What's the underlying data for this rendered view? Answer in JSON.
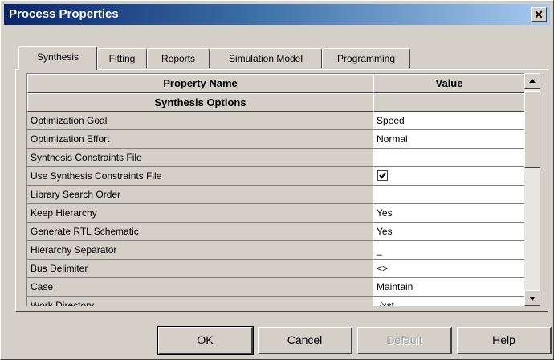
{
  "window": {
    "title": "Process Properties",
    "close_glyph": "✕"
  },
  "tabs": [
    {
      "label": "Synthesis",
      "active": true
    },
    {
      "label": "Fitting",
      "active": false
    },
    {
      "label": "Reports",
      "active": false
    },
    {
      "label": "Simulation Model",
      "active": false
    },
    {
      "label": "Programming",
      "active": false
    }
  ],
  "grid": {
    "columns": {
      "name": "Property Name",
      "value": "Value"
    },
    "section": "Synthesis Options",
    "rows": [
      {
        "name": "Optimization Goal",
        "value": "Speed"
      },
      {
        "name": "Optimization Effort",
        "value": "Normal"
      },
      {
        "name": "Synthesis Constraints File",
        "value": ""
      },
      {
        "name": "Use Synthesis Constraints File",
        "value": "",
        "checked": true
      },
      {
        "name": "Library Search Order",
        "value": ""
      },
      {
        "name": "Keep Hierarchy",
        "value": "Yes"
      },
      {
        "name": "Generate RTL Schematic",
        "value": "Yes"
      },
      {
        "name": "Hierarchy Separator",
        "value": "_"
      },
      {
        "name": "Bus Delimiter",
        "value": "<>"
      },
      {
        "name": "Case",
        "value": "Maintain"
      },
      {
        "name": "Work Directory",
        "value": "./xst"
      }
    ]
  },
  "scrollbar": {
    "up_icon": "scroll-up-arrow-icon",
    "down_icon": "scroll-down-arrow-icon"
  },
  "buttons": {
    "ok": "OK",
    "cancel": "Cancel",
    "default": "Default",
    "help": "Help"
  },
  "colors": {
    "face": "#d4d0c8",
    "title_start": "#0a246a",
    "title_end": "#a6caf0"
  }
}
